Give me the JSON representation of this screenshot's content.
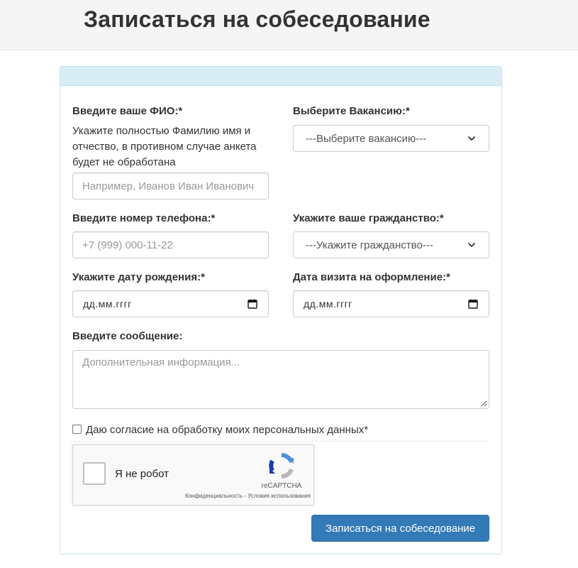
{
  "page": {
    "title": "Записаться на собеседование"
  },
  "form": {
    "fio": {
      "label": "Введите ваше ФИО:*",
      "help": "Укажите полностью Фамилию имя и отчество, в противном случае анкета будет не обработана",
      "placeholder": "Например, Иванов Иван Иванович"
    },
    "vacancy": {
      "label": "Выберите Вакансию:*",
      "selected": "---Выберите вакансию---"
    },
    "phone": {
      "label": "Введите номер телефона:*",
      "placeholder": "+7 (999) 000-11-22"
    },
    "citizenship": {
      "label": "Укажите ваше гражданство:*",
      "selected": "---Укажите гражданство---"
    },
    "birthdate": {
      "label": "Укажите дату рождения:*",
      "placeholder": "дд.мм.гггг"
    },
    "visit_date": {
      "label": "Дата визита на оформление:*",
      "placeholder": "дд.мм.гггг"
    },
    "message": {
      "label": "Введите сообщение:",
      "placeholder": "Дополнительная информация..."
    },
    "consent": {
      "label": "Даю согласие на обработку моих персональных данных*",
      "checked": false
    },
    "recaptcha": {
      "label": "Я не робот",
      "brand": "reCAPTCHA",
      "privacy": "Конфиденциальность",
      "separator": " - ",
      "terms": "Условия использования"
    },
    "submit_label": "Записаться на собеседование"
  },
  "colors": {
    "primary": "#337ab7",
    "panel_heading": "#d9edf7",
    "panel_border": "#bce8f1",
    "header_bg": "#f5f5f5"
  }
}
